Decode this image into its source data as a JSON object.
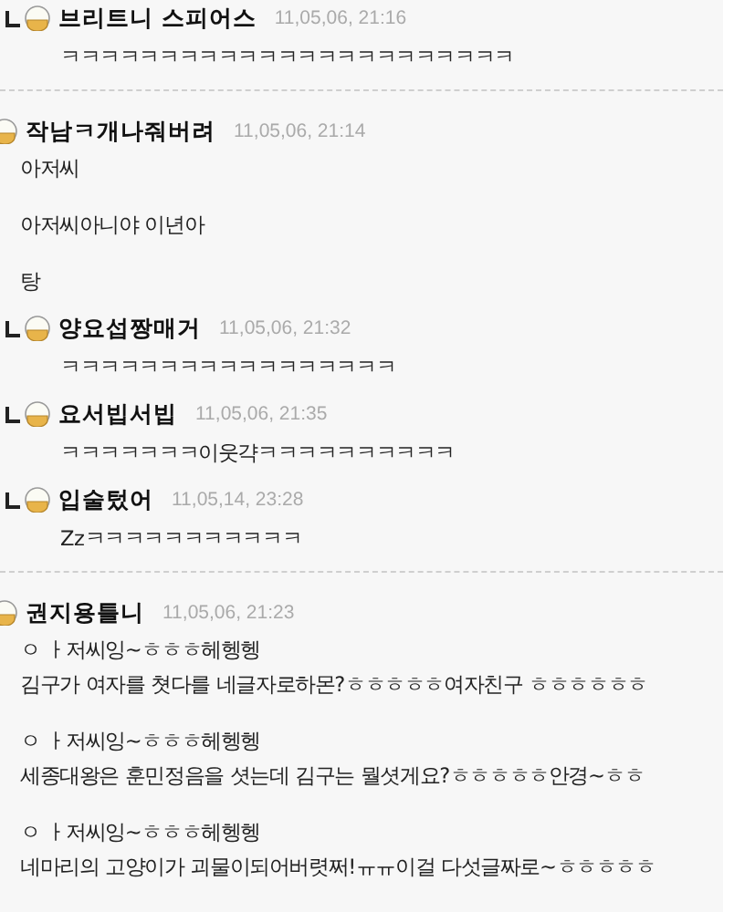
{
  "threads": [
    {
      "comments": [
        {
          "reply": true,
          "author": "브리트니 스피어스",
          "date": "11,05,06, 21:16",
          "paragraphs": [
            [
              "ㅋㅋㅋㅋㅋㅋㅋㅋㅋㅋㅋㅋㅋㅋㅋㅋㅋㅋㅋㅋㅋㅋㅋ"
            ]
          ]
        }
      ]
    },
    {
      "comments": [
        {
          "reply": false,
          "author": "작남ㅋ개나줘버려",
          "date": "11,05,06, 21:14",
          "paragraphs": [
            [
              "아저씨"
            ],
            [
              "아저씨아니야 이년아"
            ],
            [
              "탕"
            ]
          ]
        },
        {
          "reply": true,
          "author": "양요섭짱매거",
          "date": "11,05,06, 21:32",
          "paragraphs": [
            [
              "ㅋㅋㅋㅋㅋㅋㅋㅋㅋㅋㅋㅋㅋㅋㅋㅋㅋ"
            ]
          ]
        },
        {
          "reply": true,
          "author": "요서빕서빕",
          "date": "11,05,06, 21:35",
          "paragraphs": [
            [
              "ㅋㅋㅋㅋㅋㅋㅋ이웃갹ㅋㅋㅋㅋㅋㅋㅋㅋㅋㅋ"
            ]
          ]
        },
        {
          "reply": true,
          "author": "입술텄어",
          "date": "11,05,14, 23:28",
          "paragraphs": [
            [
              "Zzㅋㅋㅋㅋㅋㅋㅋㅋㅋㅋㅋ"
            ]
          ]
        }
      ]
    },
    {
      "comments": [
        {
          "reply": false,
          "author": "권지용틀니",
          "date": "11,05,06, 21:23",
          "paragraphs": [
            [
              "ㅇ ㅏ저씨잉~ㅎㅎㅎ헤헹헹",
              "김구가 여자를 쳣다를 네글자로하몬?ㅎㅎㅎㅎㅎ여자친구 ㅎㅎㅎㅎㅎㅎ"
            ],
            [
              "ㅇ ㅏ저씨잉~ㅎㅎㅎ헤헹헹",
              "세종대왕은 훈민정음을 셧는데 김구는 뭘셧게요?ㅎㅎㅎㅎㅎ안경~ㅎㅎ"
            ],
            [
              "ㅇ ㅏ저씨잉~ㅎㅎㅎ헤헹헹",
              "네마리의 고양이가 괴물이되어버렷쩌!ㅠㅠ이걸 다섯글짜로~ㅎㅎㅎㅎㅎ"
            ]
          ]
        }
      ]
    }
  ]
}
